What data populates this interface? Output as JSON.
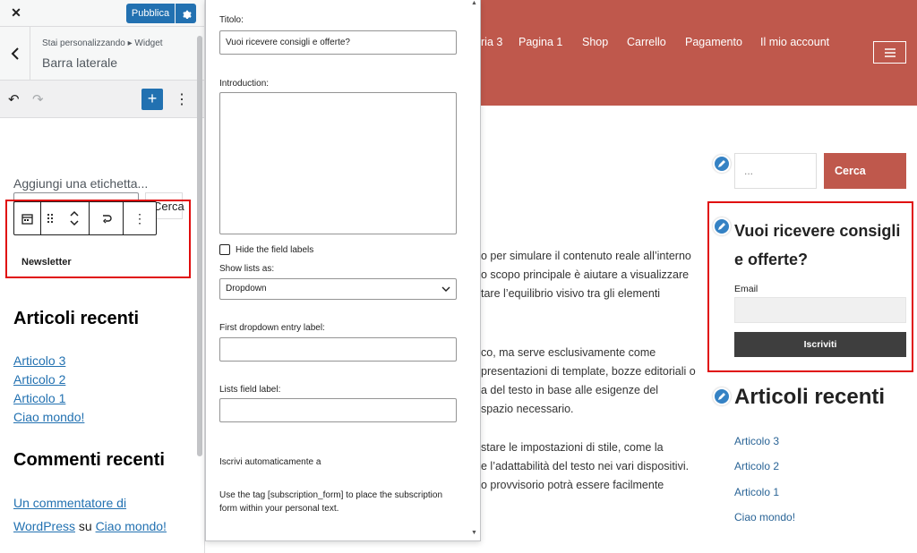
{
  "sidebar": {
    "close": "✕",
    "publish_label": "Pubblica",
    "breadcrumb": "Stai personalizzando ▸ Widget",
    "section_title": "Barra laterale",
    "add_label": "Aggiungi una etichetta...",
    "search_button": "Cerca",
    "block_name": "Newsletter",
    "recent_posts_title": "Articoli recenti",
    "recent_posts": [
      "Articolo 3",
      "Articolo 2",
      "Articolo 1",
      "Ciao mondo!"
    ],
    "recent_comments_title": "Commenti recenti",
    "comment_author_line1": "Un commentatore di",
    "comment_author_line2": "WordPress",
    "comment_on": "su",
    "comment_post": "Ciao mondo!"
  },
  "form": {
    "title_label": "Titolo:",
    "title_value": "Vuoi ricevere consigli e offerte?",
    "intro_label": "Introduction:",
    "hide_labels": "Hide the field labels",
    "show_lists_label": "Show lists as:",
    "show_lists_value": "Dropdown",
    "first_entry_label": "First dropdown entry label:",
    "lists_field_label": "Lists field label:",
    "auto_subscribe": "Iscrivi automaticamente a",
    "help_text_1": "Use the tag [subscription_form] to place the subscription",
    "help_text_2": "form within your personal text."
  },
  "preview": {
    "nav": [
      "ria 3",
      "Pagina 1",
      "Shop",
      "Carrello",
      "Pagamento",
      "Il mio account"
    ],
    "paragraph1": [
      "o per simulare il contenuto reale all’interno",
      "o scopo principale è aiutare a visualizzare",
      "tare l’equilibrio visivo tra gli elementi"
    ],
    "paragraph2": [
      "co, ma serve esclusivamente come",
      "presentazioni di template, bozze editoriali o",
      "a del testo in base alle esigenze del",
      "spazio necessario."
    ],
    "paragraph3": [
      "stare le impostazioni di stile, come la",
      "e l’adattabilità del testo nei vari dispositivi.",
      "o provvisorio potrà essere facilmente"
    ],
    "search_placeholder": "...",
    "search_button": "Cerca",
    "newsletter_title": "Vuoi ricevere consigli e offerte?",
    "email_label": "Email",
    "subscribe_button": "Iscriviti",
    "recent_title": "Articoli recenti",
    "recent_posts": [
      "Articolo 3",
      "Articolo 2",
      "Articolo 1",
      "Ciao mondo!"
    ]
  },
  "colors": {
    "header": "#bf584c",
    "wp_blue": "#2271b1",
    "highlight": "#e00d0d"
  }
}
